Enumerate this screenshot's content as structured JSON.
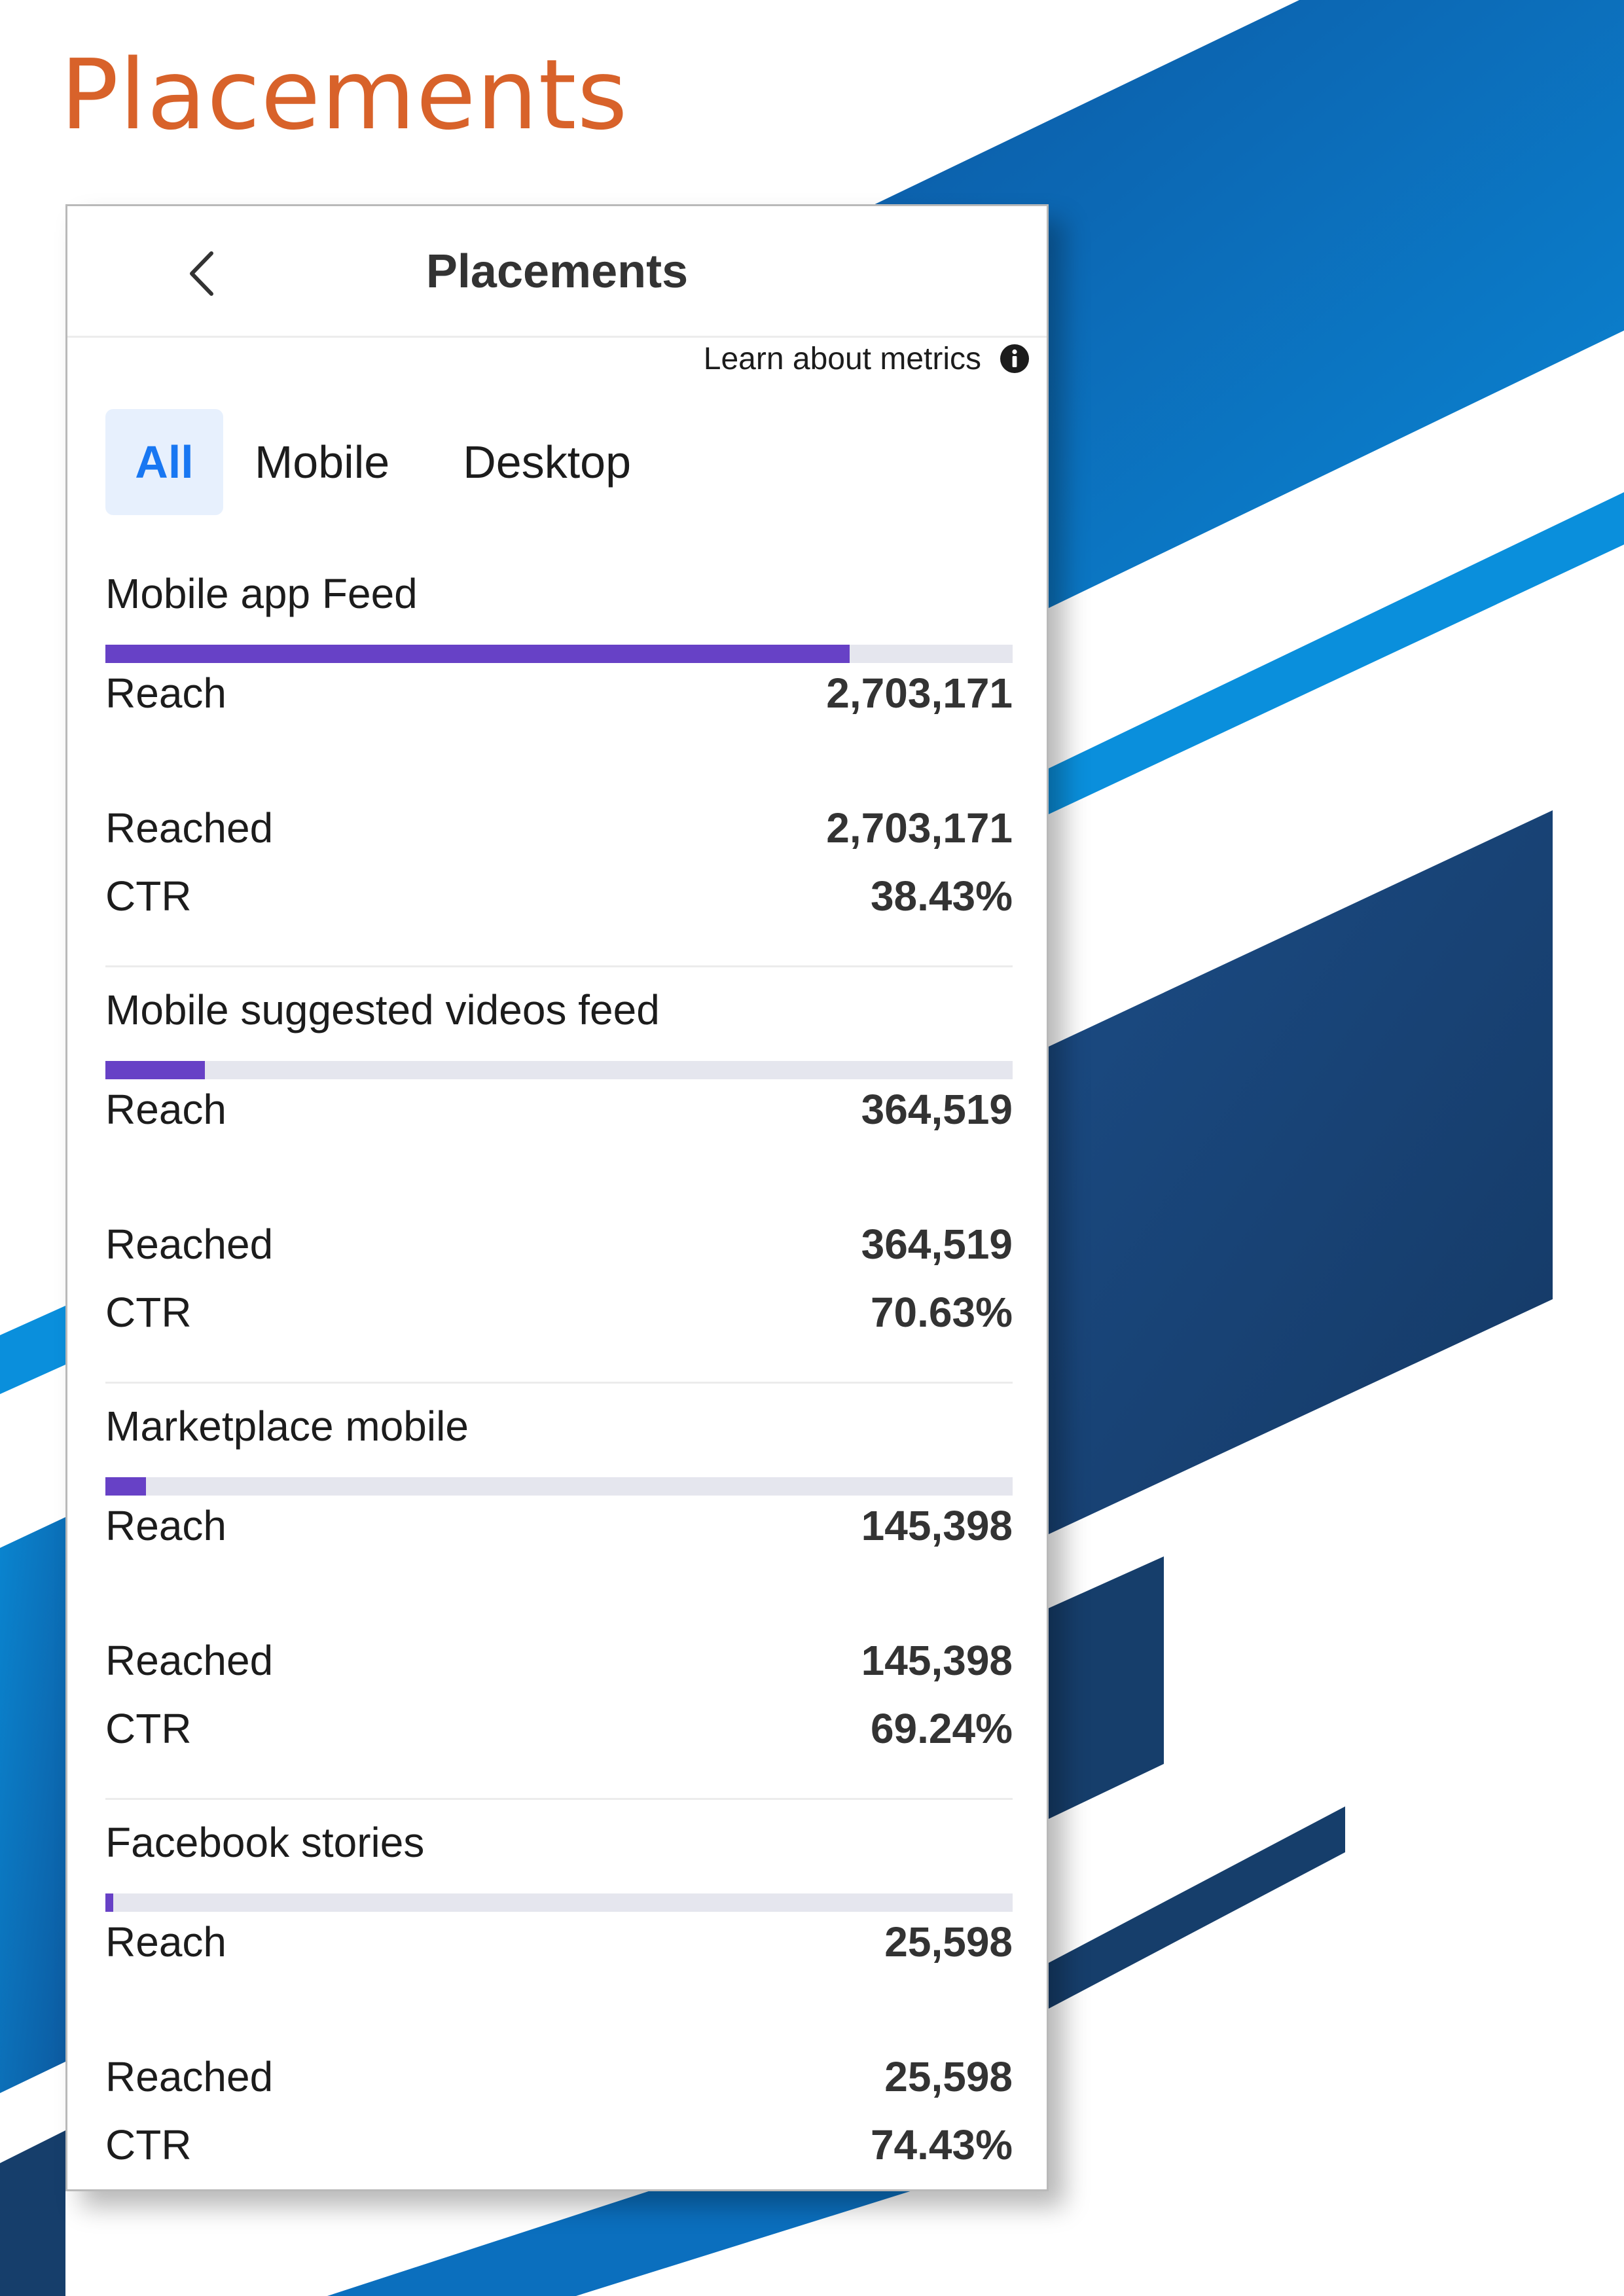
{
  "page": {
    "heading": "Placements",
    "heading_color": "#D8622A"
  },
  "colors": {
    "bar_fill": "#6741C6",
    "bar_track": "#E5E6EE",
    "active_tab_bg": "#E7F0FD",
    "active_tab_text": "#1877F2",
    "stripe_light": "#0A8FDC",
    "stripe_mid": "#0B6FBE",
    "stripe_dark": "#163E6B"
  },
  "panel": {
    "title": "Placements",
    "back_icon": "chevron-left-icon",
    "learn_link": "Learn about metrics",
    "info_icon": "info-icon",
    "tabs": [
      {
        "label": "All",
        "active": true
      },
      {
        "label": "Mobile",
        "active": false
      },
      {
        "label": "Desktop",
        "active": false
      }
    ],
    "metric_labels": {
      "reach": "Reach",
      "reached": "Reached",
      "ctr": "CTR"
    },
    "placements": [
      {
        "name": "Mobile app Feed",
        "reach": "2,703,171",
        "reached": "2,703,171",
        "ctr": "38.43%",
        "bar_fraction": 0.82
      },
      {
        "name": "Mobile suggested videos feed",
        "reach": "364,519",
        "reached": "364,519",
        "ctr": "70.63%",
        "bar_fraction": 0.11
      },
      {
        "name": "Marketplace mobile",
        "reach": "145,398",
        "reached": "145,398",
        "ctr": "69.24%",
        "bar_fraction": 0.045
      },
      {
        "name": "Facebook stories",
        "reach": "25,598",
        "reached": "25,598",
        "ctr": "74.43%",
        "bar_fraction": 0.009
      }
    ]
  }
}
